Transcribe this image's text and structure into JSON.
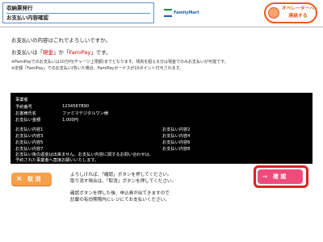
{
  "header": {
    "line1": "収納票発行",
    "line2": "お支払い内容確認",
    "logo_text": "FamilyMart",
    "operator_button": [
      "オペレーターへ",
      "連絡する"
    ]
  },
  "messages": {
    "confirm_question": "お支払いの内容はこれでよろしいですか。",
    "method_prefix": "お支払いは「",
    "method_cash": "現金",
    "method_mid": "」か「",
    "method_famipay": "FamiPay",
    "method_suffix": "」です。",
    "note1": "※FamiPayでのお支払いは10万円(チャージ上限額)までとなります。残高を超える分は現金でのみお支払いが可能です。",
    "note2": "※定額「FamiPay」でのお支払い(負いた場合、FamiPayボーナスが10ポイント付与されます。"
  },
  "details": {
    "section_label": "事業者",
    "fields": [
      {
        "label": "予約番号",
        "value": "1234567890"
      },
      {
        "label": "お客様氏名",
        "value": "ファミマデジタルワン様"
      },
      {
        "label": "お支払い金額",
        "value": "1,000円"
      }
    ],
    "items_left": [
      "お支払い内容1",
      "お支払い内容3",
      "お支払い内容5",
      "お支払い内容7"
    ],
    "items_right": [
      "お支払い内容2",
      "お支払い内容4",
      "お支払い内容6",
      "お支払い内容8"
    ],
    "footer1": "お支払い後の返金は出来ません。お支払い内容に関するお問い合わせは、",
    "footer2": "予約された事業者へ直接お願いいたします。"
  },
  "buttons": {
    "cancel": "取 消",
    "confirm": "確 認"
  },
  "instructions": {
    "line1": "よろしければ、「確認」ボタンを押してください。",
    "line2": "取り消す場合は、「取消」ボタンを押してください。",
    "line3": "確認ボタンを押した後、申込券が出てきますので",
    "line4": "記載の有効期限内にレジにてお支払いください。"
  },
  "colors": {
    "accent_red": "#d40000",
    "cancel_orange": "#f5a04a",
    "confirm_pink": "#ef4b7b",
    "highlight_red": "#e02020",
    "operator_orange": "#e85b1c",
    "panel_black": "#000000"
  }
}
